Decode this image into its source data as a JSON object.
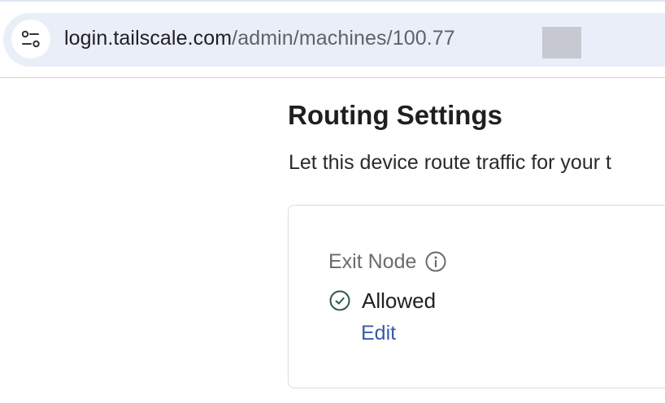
{
  "browser": {
    "url_host": "login.tailscale.com",
    "url_path": "/admin/machines/100.77",
    "site_info_icon": "tune-icon"
  },
  "routing": {
    "title": "Routing Settings",
    "description": "Let this device route traffic for your t",
    "exit_node": {
      "label": "Exit Node",
      "info_icon": "info-icon",
      "status_icon": "check-circle-icon",
      "status": "Allowed",
      "edit_label": "Edit"
    }
  },
  "colors": {
    "accent_link": "#3b5aa8",
    "status_ok": "#2f5a46"
  }
}
